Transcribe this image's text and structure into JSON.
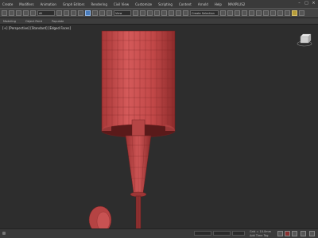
{
  "menu": {
    "items": [
      "Create",
      "Modifiers",
      "Animation",
      "Graph Editors",
      "Rendering",
      "Civil View",
      "Customize",
      "Scripting",
      "Content",
      "Arnold",
      "Help",
      "MAXPLUS2"
    ]
  },
  "toolbar": {
    "filter_value": "All",
    "view_value": "View",
    "selection_set_placeholder": "Create Selection Set"
  },
  "ribbon": {
    "tabs": [
      "Modeling",
      "Object Paint",
      "Populate"
    ]
  },
  "viewport": {
    "label": "[+] [Perspective] [Standard] [Edged Faces]",
    "mesh_color": "#c44a4a",
    "edge_color": "#6a1f1f",
    "background": "#2d2d2d"
  },
  "statusbar": {
    "selection_info": "",
    "grid_value": "Grid = 10.0mm",
    "add_time_tag": "Add Time Tag",
    "auto_key": "Auto Key",
    "set_key": "Set Key"
  }
}
